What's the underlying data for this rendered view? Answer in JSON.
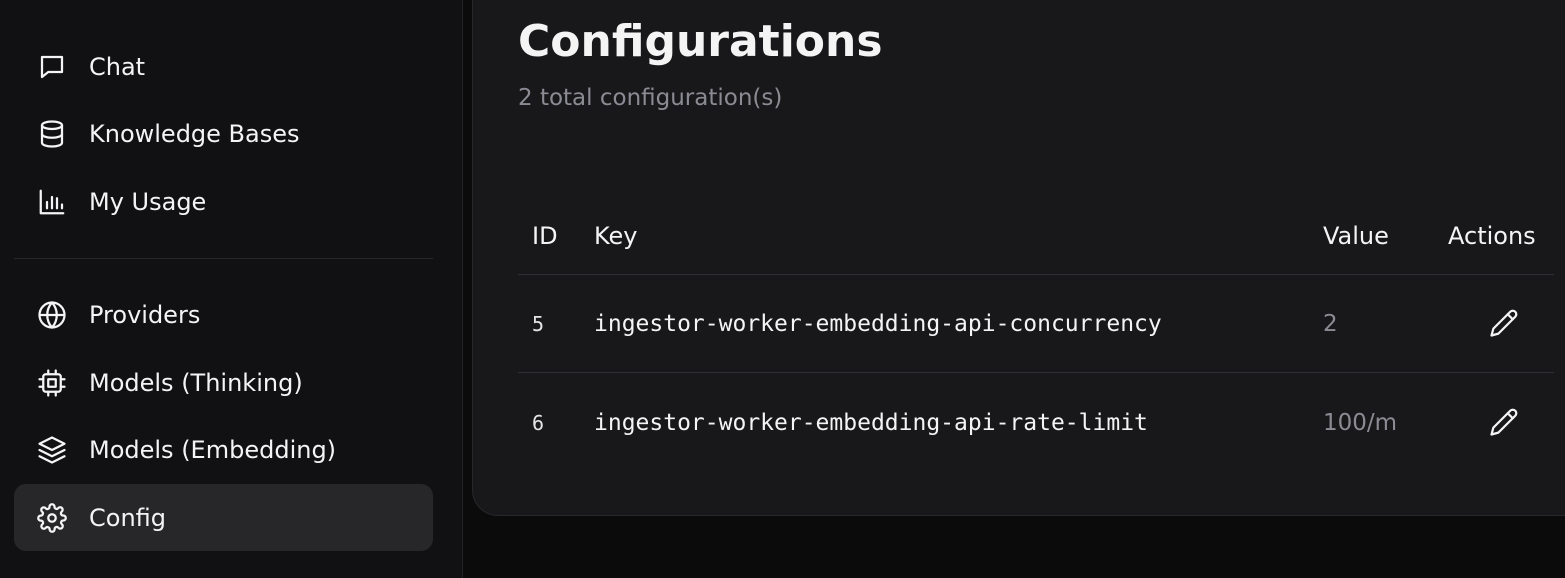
{
  "sidebar": {
    "primary": [
      {
        "label": "Chat",
        "icon": "message-square-icon"
      },
      {
        "label": "Knowledge Bases",
        "icon": "database-icon"
      },
      {
        "label": "My Usage",
        "icon": "bar-chart-icon"
      }
    ],
    "admin": [
      {
        "label": "Providers",
        "icon": "globe-icon"
      },
      {
        "label": "Models (Thinking)",
        "icon": "cpu-icon"
      },
      {
        "label": "Models (Embedding)",
        "icon": "layers-icon"
      },
      {
        "label": "Config",
        "icon": "gear-icon",
        "active": true
      }
    ]
  },
  "main": {
    "title": "Configurations",
    "subtitle": "2 total configuration(s)",
    "table": {
      "headers": {
        "id": "ID",
        "key": "Key",
        "value": "Value",
        "actions": "Actions"
      },
      "rows": [
        {
          "id": "5",
          "key": "ingestor-worker-embedding-api-concurrency",
          "value": "2",
          "action_icon": "pencil-icon"
        },
        {
          "id": "6",
          "key": "ingestor-worker-embedding-api-rate-limit",
          "value": "100/m",
          "action_icon": "pencil-icon"
        }
      ]
    }
  },
  "colors": {
    "background": "#0b0b0c",
    "sidebar": "#111113",
    "panel": "#18181b",
    "active_item": "#27272a",
    "muted_text": "#8b8b93",
    "text": "#f4f4f5"
  }
}
